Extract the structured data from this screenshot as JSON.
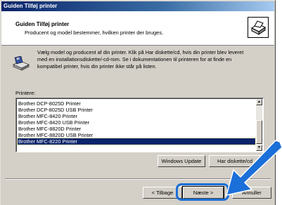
{
  "window": {
    "title": "Guiden Tilføj printer"
  },
  "header": {
    "title": "Guiden Tilføj printer",
    "subtitle": "Producent og model bestemmer, hvilken printer der bruges.",
    "icon": "printer-wizard-icon"
  },
  "intro": {
    "icon": "printer-disk-icon",
    "lines": [
      "Vælg model og producent af din printer. Klik på Har diskette/cd, hvis din printer blev leveret",
      "med en installationsdiskette/-cd-rom. Se i dokumentationen til printeren for at finde en",
      "kompatibel printer, hvis din printer ikke står på listen."
    ]
  },
  "printers": {
    "label": "Printere:",
    "items": [
      "Brother DCP-8025D Printer",
      "Brother DCP-8025D USB Printer",
      "Brother MFC-8420 Printer",
      "Brother MFC-8420 USB Printer",
      "Brother MFC-8820D Printer",
      "Brother MFC-8820D USB Printer",
      "Brother MFC-8220 Printer"
    ],
    "selected_index": 6
  },
  "buttons": {
    "windows_update": "Windows Update",
    "have_disk": "Har diskette/cd",
    "back": "< Tilbage",
    "next": "Næste >",
    "cancel": "Annuller"
  },
  "overlay": {
    "arrow_color": "#1a6fd8"
  }
}
